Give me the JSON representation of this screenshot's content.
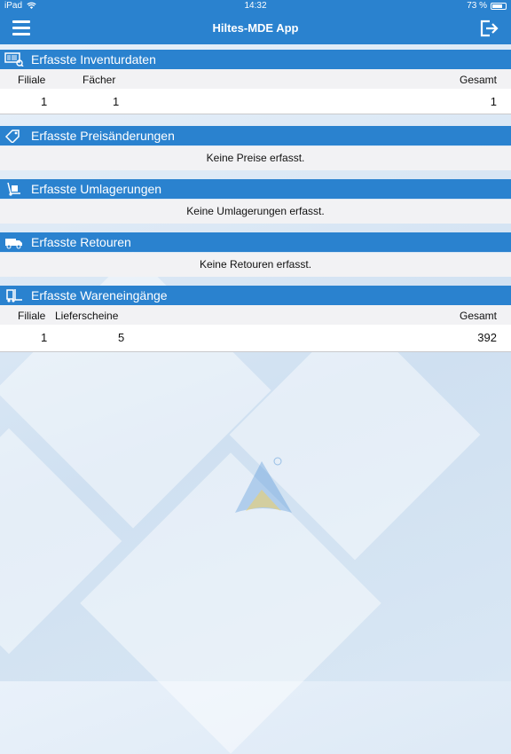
{
  "status_bar": {
    "device": "iPad",
    "time": "14:32",
    "battery": "73 %"
  },
  "navbar": {
    "title": "Hiltes-MDE App",
    "menu_icon": "hamburger-icon",
    "logout_icon": "logout-icon"
  },
  "sections": {
    "inventur": {
      "title": "Erfasste Inventurdaten",
      "columns": {
        "filiale": "Filiale",
        "faecher": "Fächer",
        "gesamt": "Gesamt"
      },
      "row": {
        "filiale": "1",
        "faecher": "1",
        "gesamt": "1"
      }
    },
    "preis": {
      "title": "Erfasste Preisänderungen",
      "empty": "Keine Preise erfasst."
    },
    "umlagerung": {
      "title": "Erfasste Umlagerungen",
      "empty": "Keine Umlagerungen erfasst."
    },
    "retouren": {
      "title": "Erfasste Retouren",
      "empty": "Keine Retouren erfasst."
    },
    "wareneingang": {
      "title": "Erfasste Wareneingänge",
      "columns": {
        "filiale": "Filiale",
        "lieferscheine": "Lieferscheine",
        "gesamt": "Gesamt"
      },
      "row": {
        "filiale": "1",
        "lieferscheine": "5",
        "gesamt": "392"
      }
    }
  },
  "colors": {
    "accent": "#2a82cf",
    "row_alt": "#f2f2f4"
  }
}
